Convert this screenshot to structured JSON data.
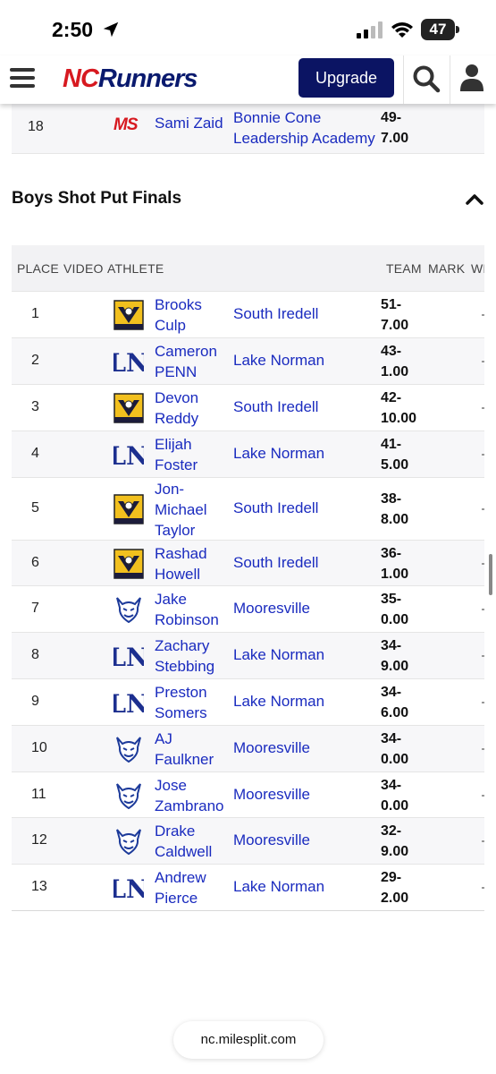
{
  "status_bar": {
    "time": "2:50",
    "battery": "47"
  },
  "header": {
    "logo_nc": "NC",
    "logo_runners": "Runners",
    "upgrade_label": "Upgrade"
  },
  "previous_row": {
    "place": "18",
    "logo_text": "MS",
    "athlete": "Sami Zaid",
    "team_line1": "Bonnie Cone",
    "team_line2": "Leadership Academy",
    "mark_line1": "49-",
    "mark_line2": "7.00"
  },
  "section": {
    "title": "Boys Shot Put Finals"
  },
  "table": {
    "headers": {
      "place": "PLACE",
      "video": "VIDEO",
      "athlete": "ATHLETE",
      "team": "TEAM",
      "mark": "MARK",
      "wind": "WI"
    },
    "rows": [
      {
        "place": "1",
        "logo": "south-iredell",
        "athlete_line1": "Brooks",
        "athlete_line2": "Culp",
        "athlete_line3": "",
        "team": "South Iredell",
        "mark_line1": "51-",
        "mark_line2": "7.00"
      },
      {
        "place": "2",
        "logo": "lake-norman",
        "athlete_line1": "Cameron",
        "athlete_line2": "PENN",
        "athlete_line3": "",
        "team": "Lake Norman",
        "mark_line1": "43-",
        "mark_line2": "1.00"
      },
      {
        "place": "3",
        "logo": "south-iredell",
        "athlete_line1": "Devon",
        "athlete_line2": "Reddy",
        "athlete_line3": "",
        "team": "South Iredell",
        "mark_line1": "42-",
        "mark_line2": "10.00"
      },
      {
        "place": "4",
        "logo": "lake-norman",
        "athlete_line1": "Elijah",
        "athlete_line2": "Foster",
        "athlete_line3": "",
        "team": "Lake Norman",
        "mark_line1": "41-",
        "mark_line2": "5.00"
      },
      {
        "place": "5",
        "logo": "south-iredell",
        "athlete_line1": "Jon-",
        "athlete_line2": "Michael",
        "athlete_line3": "Taylor",
        "team": "South Iredell",
        "mark_line1": "38-",
        "mark_line2": "8.00"
      },
      {
        "place": "6",
        "logo": "south-iredell",
        "athlete_line1": "Rashad",
        "athlete_line2": "Howell",
        "athlete_line3": "",
        "team": "South Iredell",
        "mark_line1": "36-",
        "mark_line2": "1.00"
      },
      {
        "place": "7",
        "logo": "mooresville",
        "athlete_line1": "Jake",
        "athlete_line2": "Robinson",
        "athlete_line3": "",
        "team": "Mooresville",
        "mark_line1": "35-",
        "mark_line2": "0.00"
      },
      {
        "place": "8",
        "logo": "lake-norman",
        "athlete_line1": "Zachary",
        "athlete_line2": "Stebbing",
        "athlete_line3": "",
        "team": "Lake Norman",
        "mark_line1": "34-",
        "mark_line2": "9.00"
      },
      {
        "place": "9",
        "logo": "lake-norman",
        "athlete_line1": "Preston",
        "athlete_line2": "Somers",
        "athlete_line3": "",
        "team": "Lake Norman",
        "mark_line1": "34-",
        "mark_line2": "6.00"
      },
      {
        "place": "10",
        "logo": "mooresville",
        "athlete_line1": "AJ",
        "athlete_line2": "Faulkner",
        "athlete_line3": "",
        "team": "Mooresville",
        "mark_line1": "34-",
        "mark_line2": "0.00"
      },
      {
        "place": "11",
        "logo": "mooresville",
        "athlete_line1": "Jose",
        "athlete_line2": "Zambrano",
        "athlete_line3": "",
        "team": "Mooresville",
        "mark_line1": "34-",
        "mark_line2": "0.00"
      },
      {
        "place": "12",
        "logo": "mooresville",
        "athlete_line1": "Drake",
        "athlete_line2": "Caldwell",
        "athlete_line3": "",
        "team": "Mooresville",
        "mark_line1": "32-",
        "mark_line2": "9.00"
      },
      {
        "place": "13",
        "logo": "lake-norman",
        "athlete_line1": "Andrew",
        "athlete_line2": "Pierce",
        "athlete_line3": "",
        "team": "Lake Norman",
        "mark_line1": "29-",
        "mark_line2": "2.00"
      }
    ]
  },
  "browser": {
    "url": "nc.milesplit.com"
  },
  "colors": {
    "brand_red": "#d71920",
    "brand_navy": "#0b1463",
    "link_blue": "#1a2bbf",
    "south_iredell_gold": "#f2c01e",
    "lake_norman_blue": "#1c2f8f"
  }
}
